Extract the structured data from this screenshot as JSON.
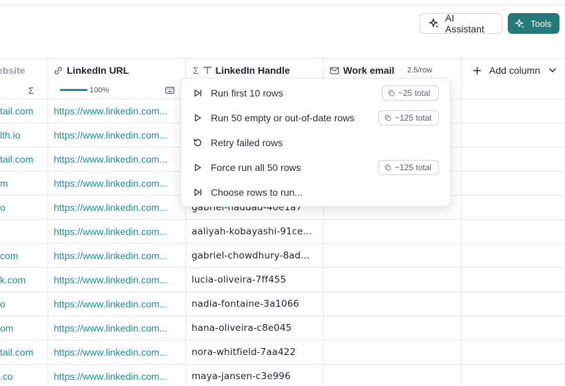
{
  "toolbar": {
    "ai_assistant_label": "AI Assistant",
    "tools_label": "Tools"
  },
  "columns": {
    "website": {
      "label": "ebsite"
    },
    "linkedin_url": {
      "label": "LinkedIn URL",
      "progress_text": "100%",
      "progress_value": 1.0
    },
    "linkedin_handle": {
      "label": "LinkedIn Handle"
    },
    "work_email": {
      "label": "Work email",
      "rate": "2.5/row"
    },
    "add_column": {
      "label": "Add column"
    }
  },
  "rows": [
    {
      "website": "tail.com",
      "url": "https://www.linkedin.com...",
      "handle": ""
    },
    {
      "website": "lth.io",
      "url": "https://www.linkedin.com...",
      "handle": ""
    },
    {
      "website": "tail.com",
      "url": "https://www.linkedin.com...",
      "handle": ""
    },
    {
      "website": "m",
      "url": "https://www.linkedin.com...",
      "handle": ""
    },
    {
      "website": "o",
      "url": "https://www.linkedin.com...",
      "handle": "gabriel-haddad-40e1a7"
    },
    {
      "website": "",
      "url": "https://www.linkedin.com...",
      "handle": "aaliyah-kobayashi-91ce..."
    },
    {
      "website": "com",
      "url": "https://www.linkedin.com...",
      "handle": "gabriel-chowdhury-8ad..."
    },
    {
      "website": "k.com",
      "url": "https://www.linkedin.com...",
      "handle": "lucia-oliveira-7ff455"
    },
    {
      "website": "o",
      "url": "https://www.linkedin.com...",
      "handle": "nadia-fontaine-3a1066"
    },
    {
      "website": "om",
      "url": "https://www.linkedin.com...",
      "handle": "hana-oliveira-c8e045"
    },
    {
      "website": "tail.com",
      "url": "https://www.linkedin.com...",
      "handle": "nora-whitfield-7aa422"
    },
    {
      "website": ".co",
      "url": "https://www.linkedin.com...",
      "handle": "maya-jansen-c3e996"
    }
  ],
  "run_menu": {
    "items": [
      {
        "label": "Run first 10 rows",
        "icon": "skip-forward-icon",
        "badge": "~25 total"
      },
      {
        "label": "Run 50 empty or out-of-date rows",
        "icon": "play-icon",
        "badge": "~125 total"
      },
      {
        "label": "Retry failed rows",
        "icon": "retry-icon",
        "badge": ""
      },
      {
        "label": "Force run all 50 rows",
        "icon": "play-icon",
        "badge": "~125 total"
      },
      {
        "label": "Choose rows to run...",
        "icon": "skip-forward-icon",
        "badge": ""
      }
    ]
  },
  "colors": {
    "accent": "#247a78",
    "link": "#1f8f88"
  }
}
